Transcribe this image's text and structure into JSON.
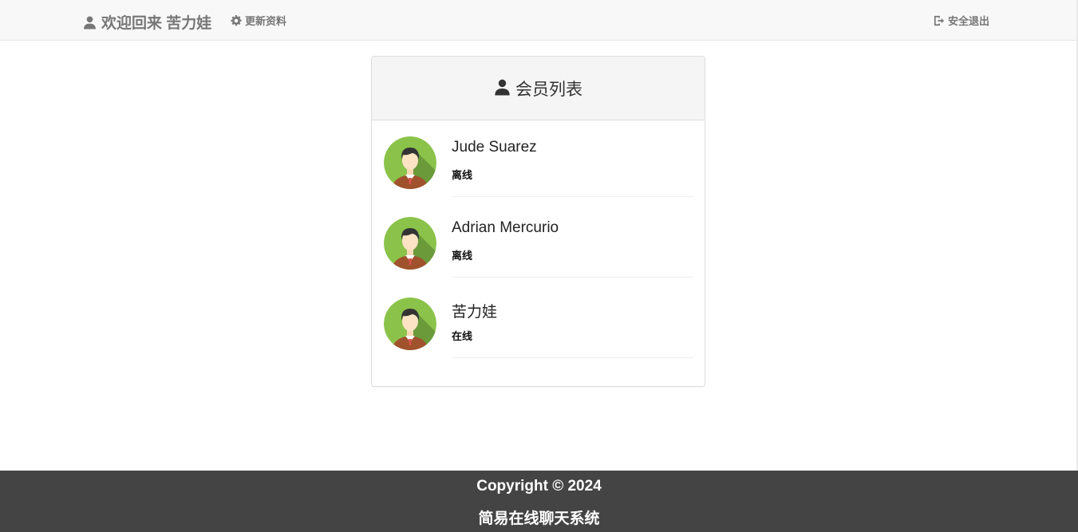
{
  "navbar": {
    "welcome_text": "欢迎回来 苦力娃",
    "update_label": "更新资料",
    "logout_label": "安全退出"
  },
  "panel": {
    "title": "会员列表"
  },
  "members": [
    {
      "name": "Jude Suarez",
      "status": "离线"
    },
    {
      "name": "Adrian Mercurio",
      "status": "离线"
    },
    {
      "name": "苦力娃",
      "status": "在线"
    }
  ],
  "footer": {
    "copyright": "Copyright © 2024",
    "system_name": "简易在线聊天系统"
  },
  "colors": {
    "navbar_bg": "#f8f8f8",
    "nav_text": "#777777",
    "footer_bg": "#444444",
    "avatar_green": "#8bc34a"
  },
  "icons": {
    "brand": "user-icon",
    "update": "gear-icon",
    "logout": "logout-icon",
    "panel": "user-icon"
  }
}
